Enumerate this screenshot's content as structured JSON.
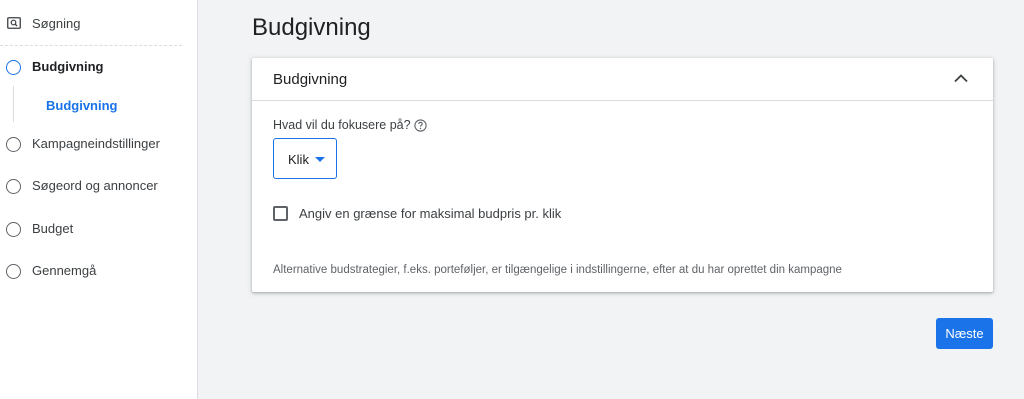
{
  "sidebar": {
    "search": {
      "label": "Søgning",
      "icon": "search-icon"
    },
    "steps": [
      {
        "label": "Budgivning",
        "active": true
      },
      {
        "label": "Kampagneindstillinger",
        "active": false
      },
      {
        "label": "Søgeord og annoncer",
        "active": false
      },
      {
        "label": "Budget",
        "active": false
      },
      {
        "label": "Gennemgå",
        "active": false
      }
    ],
    "substep": {
      "label": "Budgivning"
    }
  },
  "main": {
    "title": "Budgivning",
    "card": {
      "title": "Budgivning",
      "question": "Hvad vil du fokusere på?",
      "select_value": "Klik",
      "checkbox_label": "Angiv en grænse for maksimal budpris pr. klik",
      "checkbox_checked": false,
      "note": "Alternative budstrategier, f.eks. porteføljer, er tilgængelige i indstillingerne, efter at du har oprettet din kampagne"
    },
    "next_button": "Næste"
  },
  "colors": {
    "accent": "#1a73e8",
    "background": "#f1f3f4",
    "text": "#202124",
    "muted": "#5f6368"
  }
}
